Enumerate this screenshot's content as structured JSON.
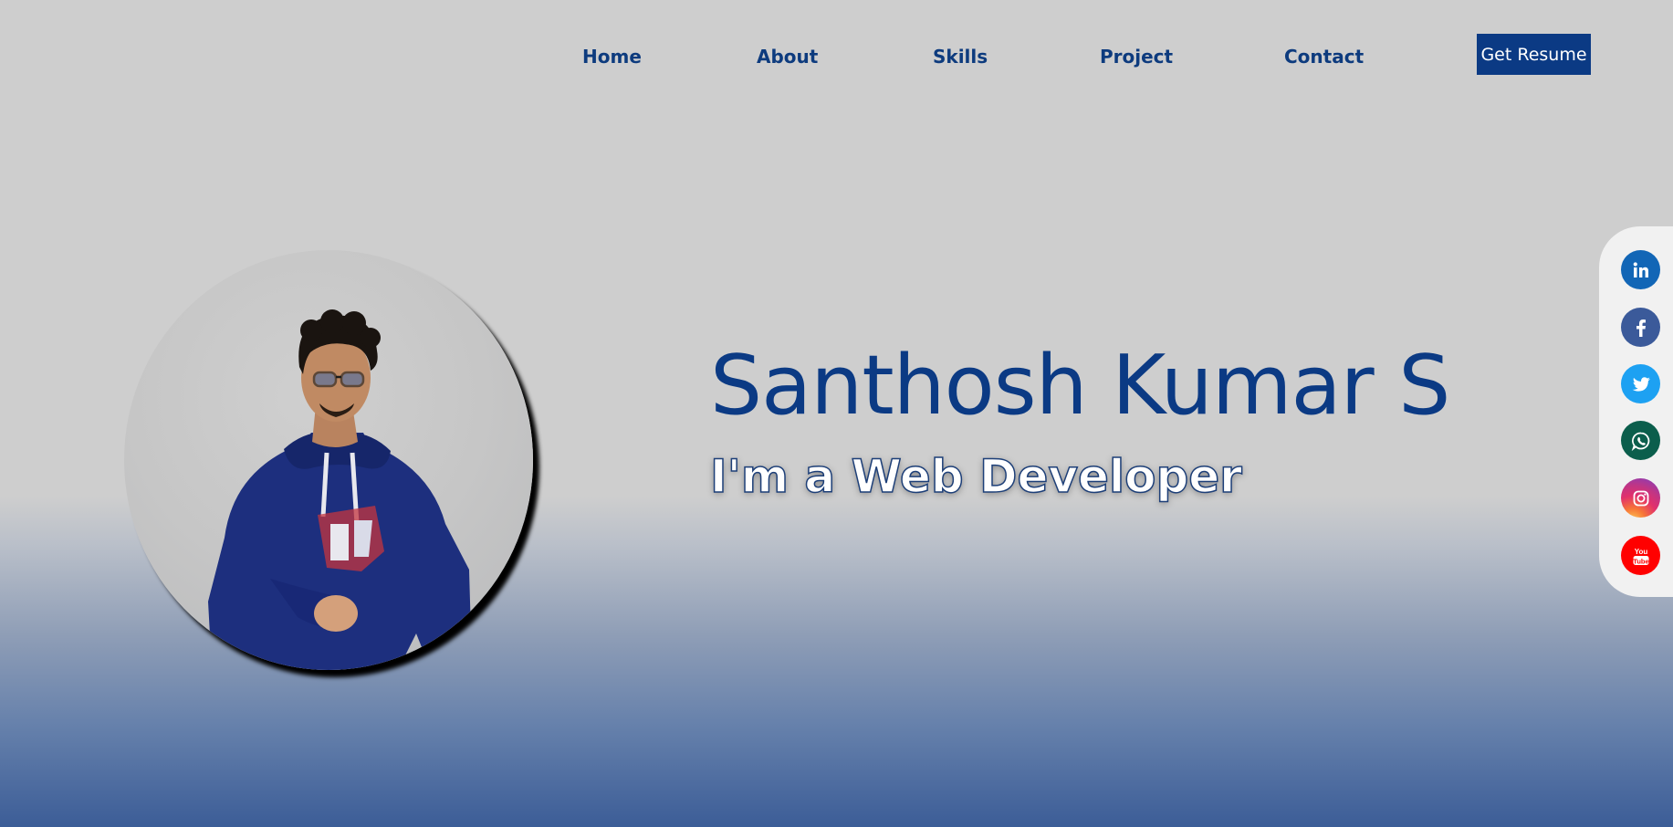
{
  "nav": {
    "links": [
      "Home",
      "About",
      "Skills",
      "Project",
      "Contact"
    ],
    "resume_label": "Get Resume"
  },
  "hero": {
    "name": "Santhosh Kumar S",
    "role": "I'm a Web Developer"
  },
  "social": {
    "icons": [
      "linkedin-icon",
      "facebook-icon",
      "twitter-icon",
      "whatsapp-icon",
      "instagram-icon",
      "youtube-icon"
    ],
    "youtube_text": "You Tube"
  },
  "colors": {
    "brand_blue": "#0b3a84",
    "linkedin": "#1266b6",
    "facebook": "#3b5a9a",
    "twitter": "#1da1f2",
    "whatsapp": "#0b5e4c",
    "youtube": "#ff0000"
  }
}
